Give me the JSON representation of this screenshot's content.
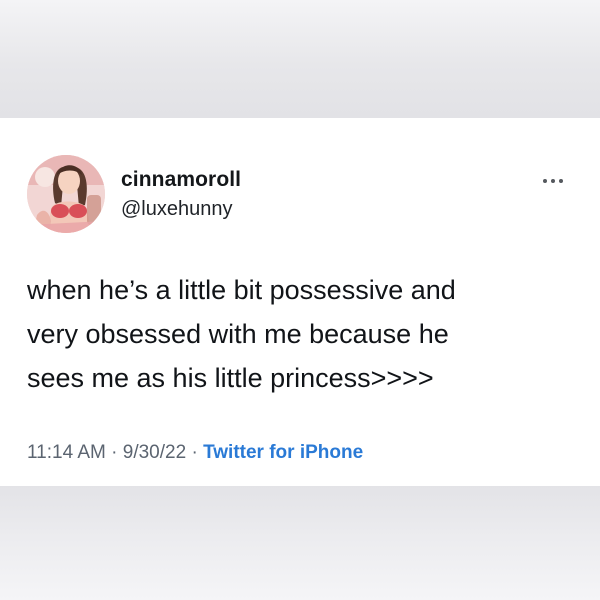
{
  "tweet": {
    "author": {
      "display_name": "cinnamoroll",
      "handle": "@luxehunny"
    },
    "text": "when he’s a little bit possessive and\nvery obsessed with me because he\nsees me as his little princess>>>>",
    "time": "11:14 AM",
    "date": "9/30/22",
    "separator": "·",
    "source": "Twitter for iPhone",
    "more_icon": "more-horizontal-icon"
  },
  "colors": {
    "card_background": "#ffffff",
    "backdrop": "#ececee",
    "text": "#111418",
    "meta_text": "#5b6470",
    "link": "#2a7ad6"
  }
}
